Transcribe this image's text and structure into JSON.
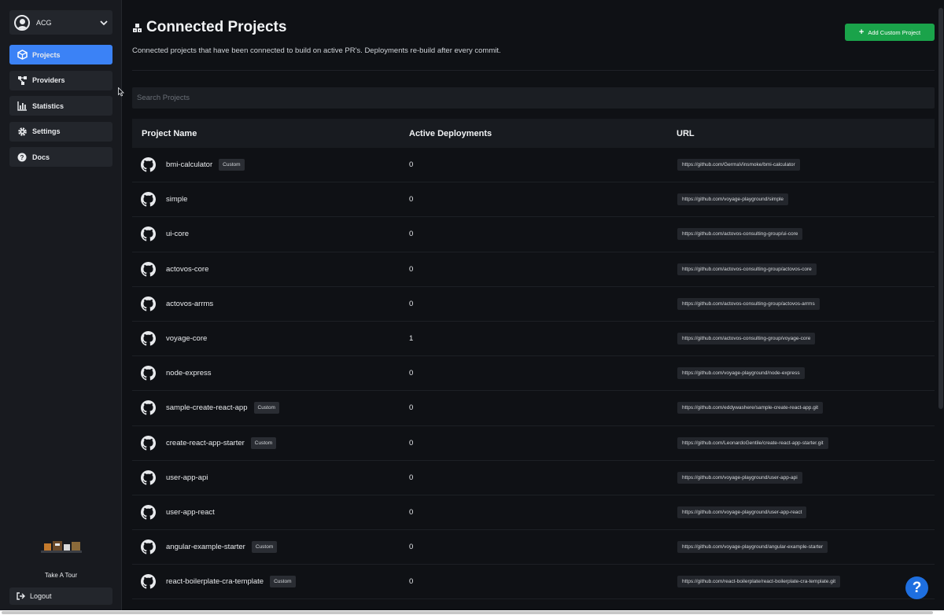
{
  "org": {
    "name": "ACG"
  },
  "nav": [
    {
      "label": "Projects",
      "icon": "cube-icon",
      "active": true
    },
    {
      "label": "Providers",
      "icon": "nodes-icon",
      "active": false
    },
    {
      "label": "Statistics",
      "icon": "bar-chart-icon",
      "active": false
    },
    {
      "label": "Settings",
      "icon": "gear-icon",
      "active": false
    },
    {
      "label": "Docs",
      "icon": "question-icon",
      "active": false
    }
  ],
  "tour": {
    "label": "Take A Tour"
  },
  "logout": {
    "label": "Logout"
  },
  "header": {
    "title": "Connected Projects",
    "description": "Connected projects that have been connected to build on active PR's. Deployments re-build after every commit.",
    "add_button": "Add Custom Project"
  },
  "search": {
    "placeholder": "Search Projects"
  },
  "table": {
    "columns": [
      "Project Name",
      "Active Deployments",
      "URL"
    ],
    "rows": [
      {
        "name": "bmi-calculator",
        "badge": "Custom",
        "deployments": "0",
        "url": "https://github.com/GermaVinsmoke/bmi-calculator"
      },
      {
        "name": "simple",
        "badge": "",
        "deployments": "0",
        "url": "https://github.com/voyage-playground/simple"
      },
      {
        "name": "ui-core",
        "badge": "",
        "deployments": "0",
        "url": "https://github.com/actovos-consulting-group/ui-core"
      },
      {
        "name": "actovos-core",
        "badge": "",
        "deployments": "0",
        "url": "https://github.com/actovos-consulting-group/actovos-core"
      },
      {
        "name": "actovos-arrms",
        "badge": "",
        "deployments": "0",
        "url": "https://github.com/actovos-consulting-group/actovos-arrms"
      },
      {
        "name": "voyage-core",
        "badge": "",
        "deployments": "1",
        "url": "https://github.com/actovos-consulting-group/voyage-core"
      },
      {
        "name": "node-express",
        "badge": "",
        "deployments": "0",
        "url": "https://github.com/voyage-playground/node-express"
      },
      {
        "name": "sample-create-react-app",
        "badge": "Custom",
        "deployments": "0",
        "url": "https://github.com/eddywashere/sample-create-react-app.git"
      },
      {
        "name": "create-react-app-starter",
        "badge": "Custom",
        "deployments": "0",
        "url": "https://github.com/LeonardoGentile/create-react-app-starter.git"
      },
      {
        "name": "user-app-api",
        "badge": "",
        "deployments": "0",
        "url": "https://github.com/voyage-playground/user-app-api"
      },
      {
        "name": "user-app-react",
        "badge": "",
        "deployments": "0",
        "url": "https://github.com/voyage-playground/user-app-react"
      },
      {
        "name": "angular-example-starter",
        "badge": "Custom",
        "deployments": "0",
        "url": "https://github.com/voyage-playground/angular-example-starter"
      },
      {
        "name": "react-boilerplate-cra-template",
        "badge": "Custom",
        "deployments": "0",
        "url": "https://github.com/react-boilerplate/react-boilerplate-cra-template.git"
      }
    ]
  },
  "help": {
    "label": "?"
  },
  "colors": {
    "accent": "#3b82f6",
    "success": "#1aa34a",
    "background": "#0f1115",
    "sidebar": "#181a1f"
  }
}
